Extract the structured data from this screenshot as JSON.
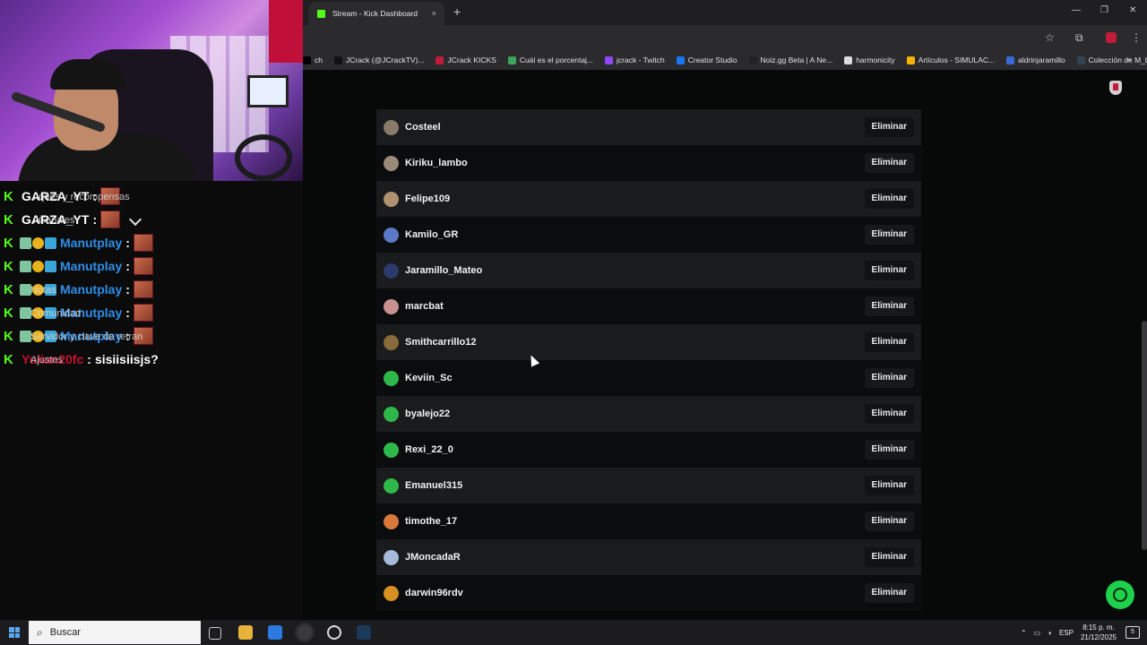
{
  "browser": {
    "tab_title": "Stream - Kick Dashboard",
    "tab_close": "×",
    "new_tab": "+",
    "window_buttons": [
      "—",
      "❐",
      "✕"
    ]
  },
  "bookmarks": [
    {
      "label": "ch",
      "color": "#000000"
    },
    {
      "label": "JCrack (@JCrackTV)...",
      "color": "#111111"
    },
    {
      "label": "JCrack KICKS",
      "color": "#c21c3a"
    },
    {
      "label": "Cuál es el porcentaj...",
      "color": "#3aa65a"
    },
    {
      "label": "jcrack - Twitch",
      "color": "#9146ff"
    },
    {
      "label": "Creator Studio",
      "color": "#1877f2"
    },
    {
      "label": "Noiz.gg Beta | A Ne...",
      "color": "#222222"
    },
    {
      "label": "harmonicity",
      "color": "#dddddd"
    },
    {
      "label": "Artículos - SIMULAC...",
      "color": "#f4b400"
    },
    {
      "label": "aldrinjaramillo",
      "color": "#3a6ad8"
    },
    {
      "label": "Colección de M_blei...",
      "color": "#334455"
    }
  ],
  "chat": [
    {
      "prefix": "K",
      "name": "GARZA_YT",
      "color": "#ffffff",
      "separator": ":",
      "text": "",
      "emote": true,
      "ghost": "...ques y recompensas",
      "badges": false
    },
    {
      "prefix": "K",
      "name": "GARZA_YT",
      "color": "#ffffff",
      "separator": ":",
      "text": "",
      "emote": true,
      "ghost": "...Canales",
      "badges": false
    },
    {
      "prefix": "K",
      "name": "Manutplay",
      "color": "#2f8fe8",
      "separator": ":",
      "text": "",
      "emote": true,
      "ghost": "...",
      "badges": true
    },
    {
      "prefix": "K",
      "name": "Manutplay",
      "color": "#2f8fe8",
      "separator": ":",
      "text": "",
      "emote": true,
      "ghost": "",
      "badges": true
    },
    {
      "prefix": "K",
      "name": "Manutplay",
      "color": "#2f8fe8",
      "separator": ":",
      "text": "",
      "emote": true,
      "ghost": "Notas",
      "badges": true
    },
    {
      "prefix": "K",
      "name": "Manutplay",
      "color": "#2f8fe8",
      "separator": ":",
      "text": "",
      "emote": true,
      "ghost": "Comunidad",
      "badges": true
    },
    {
      "prefix": "K",
      "name": "Manutplay",
      "color": "#2f8fe8",
      "separator": ":",
      "text": "",
      "emote": true,
      "ghost": "Servidor y clave de retran",
      "badges": true
    },
    {
      "prefix": "K",
      "name": "Yulian20fc",
      "color": "#c8102e",
      "separator": ":",
      "text": "sisiisiisjs?",
      "emote": false,
      "ghost": "Ajustes",
      "badges": false
    }
  ],
  "users": [
    {
      "name": "Costeel",
      "action": "Eliminar",
      "avatar": "#8a7a6a"
    },
    {
      "name": "Kiriku_lambo",
      "action": "Eliminar",
      "avatar": "#9a8a7a"
    },
    {
      "name": "Felipe109",
      "action": "Eliminar",
      "avatar": "#b09070"
    },
    {
      "name": "Kamilo_GR",
      "action": "Eliminar",
      "avatar": "#5a7ac8"
    },
    {
      "name": "Jaramillo_Mateo",
      "action": "Eliminar",
      "avatar": "#2a3a6a"
    },
    {
      "name": "marcbat",
      "action": "Eliminar",
      "avatar": "#c89090"
    },
    {
      "name": "Smithcarrillo12",
      "action": "Eliminar",
      "avatar": "#8a6a3a"
    },
    {
      "name": "Keviin_Sc",
      "action": "Eliminar",
      "avatar": "#2fb84a"
    },
    {
      "name": "byalejo22",
      "action": "Eliminar",
      "avatar": "#2fb84a"
    },
    {
      "name": "Rexi_22_0",
      "action": "Eliminar",
      "avatar": "#2fb84a"
    },
    {
      "name": "Emanuel315",
      "action": "Eliminar",
      "avatar": "#2fb84a"
    },
    {
      "name": "timothe_17",
      "action": "Eliminar",
      "avatar": "#d8783a"
    },
    {
      "name": "JMoncadaR",
      "action": "Eliminar",
      "avatar": "#a8b8d8"
    },
    {
      "name": "darwin96rdv",
      "action": "Eliminar",
      "avatar": "#d89020"
    }
  ],
  "taskbar": {
    "search_placeholder": "Buscar",
    "language": "ESP",
    "time": "8:15 p. m.",
    "date": "21/12/2025",
    "notifications": "5"
  },
  "colors": {
    "kick_green": "#53fc18",
    "page_bg": "#070808",
    "row_alt": "#191b1c"
  }
}
